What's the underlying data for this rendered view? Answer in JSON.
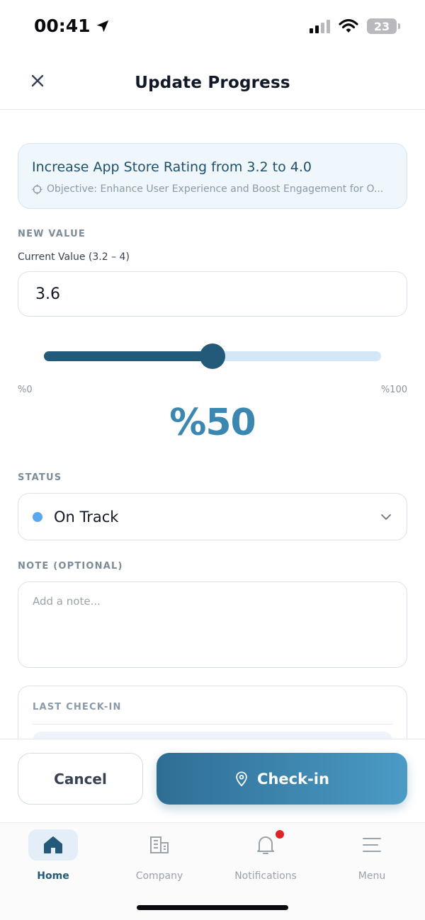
{
  "status_bar": {
    "time": "00:41",
    "battery": "23"
  },
  "header": {
    "title": "Update Progress"
  },
  "objective": {
    "title": "Increase App Store Rating from 3.2 to 4.0",
    "subtitle": "Objective: Enhance User Experience and Boost Engagement for O..."
  },
  "new_value": {
    "section_label": "NEW VALUE",
    "caption": "Current Value (3.2 – 4)",
    "value": "3.6",
    "slider_progress": 0.5,
    "min_label": "%0",
    "max_label": "%100",
    "percent_label": "%50"
  },
  "status": {
    "section_label": "STATUS",
    "selected": "On Track",
    "dot_color": "#5aa9ea"
  },
  "note": {
    "section_label": "NOTE (OPTIONAL)",
    "placeholder": "Add a note..."
  },
  "last_checkin": {
    "label": "LAST CHECK-IN"
  },
  "actions": {
    "cancel_label": "Cancel",
    "checkin_label": "Check-in"
  },
  "tabs": [
    {
      "label": "Home",
      "icon": "home-icon",
      "active": true
    },
    {
      "label": "Company",
      "icon": "building-icon",
      "active": false
    },
    {
      "label": "Notifications",
      "icon": "bell-icon",
      "active": false,
      "badge": true
    },
    {
      "label": "Menu",
      "icon": "menu-icon",
      "active": false
    }
  ],
  "colors": {
    "accent": "#235a7a",
    "accent_light": "#3c87b2",
    "notification_badge": "#e02424"
  }
}
